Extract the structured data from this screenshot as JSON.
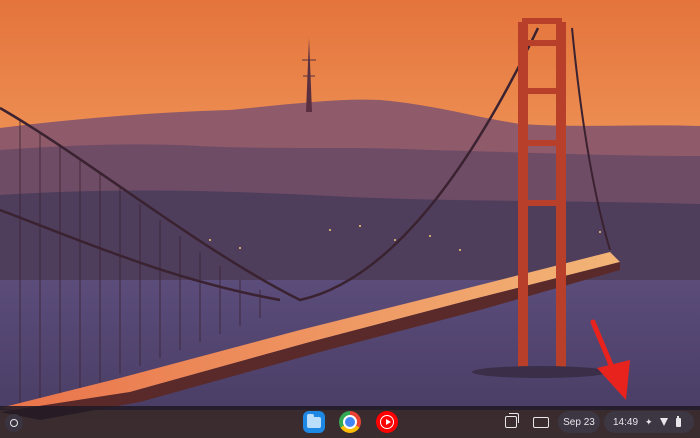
{
  "wallpaper": {
    "description_icon": "golden-gate-wallpaper"
  },
  "shelf": {
    "launcher_icon": "launcher-icon",
    "pinned_apps": [
      {
        "name": "files-app-icon"
      },
      {
        "name": "chrome-app-icon"
      },
      {
        "name": "youtube-music-app-icon"
      }
    ],
    "tray": {
      "date": "Sep 23",
      "time": "14:49"
    }
  },
  "annotation": {
    "color": "#e8231e"
  }
}
